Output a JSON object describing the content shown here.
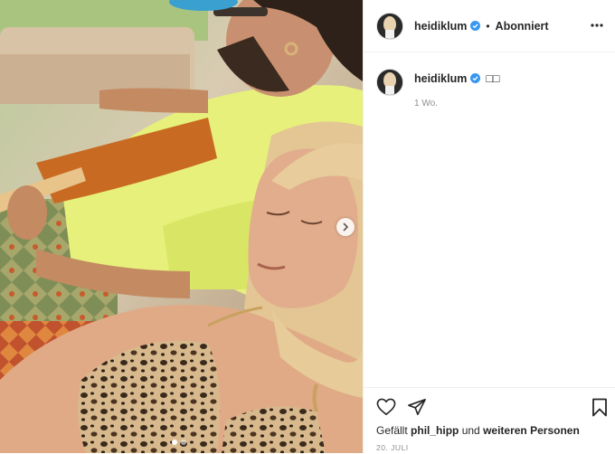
{
  "header": {
    "username": "heidiklum",
    "separator": "•",
    "follow_state": "Abonniert"
  },
  "caption": {
    "username": "heidiklum",
    "text": "□□",
    "time": "1 Wo."
  },
  "likes": {
    "prefix": "Gefällt",
    "user": "phil_hipp",
    "middle": "und",
    "others": "weiteren Personen"
  },
  "date": "20. JULI",
  "carousel": {
    "count": 2,
    "active": 0
  },
  "colors": {
    "verified": "#3897f0",
    "text": "#262626",
    "muted": "#8e8e8e",
    "border": "#efefef"
  },
  "icons": [
    "heart-icon",
    "share-icon",
    "bookmark-icon",
    "more-icon",
    "chevron-right-icon",
    "verified-icon"
  ]
}
